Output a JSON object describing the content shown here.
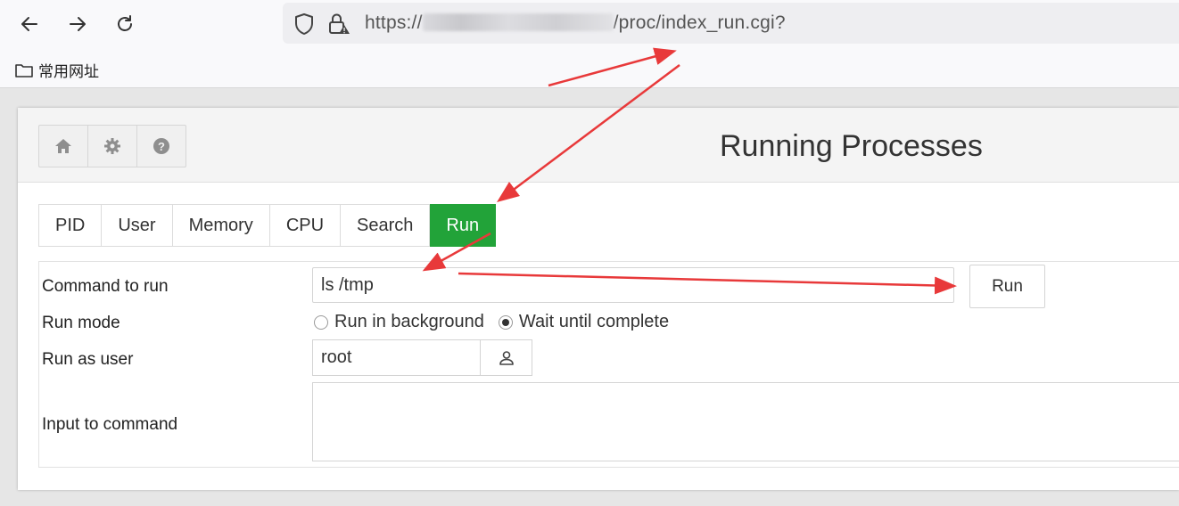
{
  "browser": {
    "url_prefix": "https://",
    "url_suffix": "/proc/index_run.cgi?",
    "bookmark_label": "常用网址",
    "icons": [
      "back-arrow-icon",
      "forward-arrow-icon",
      "reload-icon",
      "shield-icon",
      "lock-icon",
      "folder-icon"
    ]
  },
  "header": {
    "title": "Running Processes",
    "buttons": [
      "home-icon",
      "gear-icon",
      "help-icon"
    ]
  },
  "tabs": [
    {
      "label": "PID",
      "active": false
    },
    {
      "label": "User",
      "active": false
    },
    {
      "label": "Memory",
      "active": false
    },
    {
      "label": "CPU",
      "active": false
    },
    {
      "label": "Search",
      "active": false
    },
    {
      "label": "Run",
      "active": true
    }
  ],
  "form": {
    "command_label": "Command to run",
    "command_value": "ls /tmp",
    "run_button": "Run",
    "run_mode_label": "Run mode",
    "run_mode_options": [
      {
        "label": "Run in background",
        "checked": false
      },
      {
        "label": "Wait until complete",
        "checked": true
      }
    ],
    "run_as_label": "Run as user",
    "run_as_value": "root",
    "input_label": "Input to command",
    "input_value": ""
  },
  "colors": {
    "active_tab": "#22a339",
    "annotation_arrow": "#e8393a"
  }
}
